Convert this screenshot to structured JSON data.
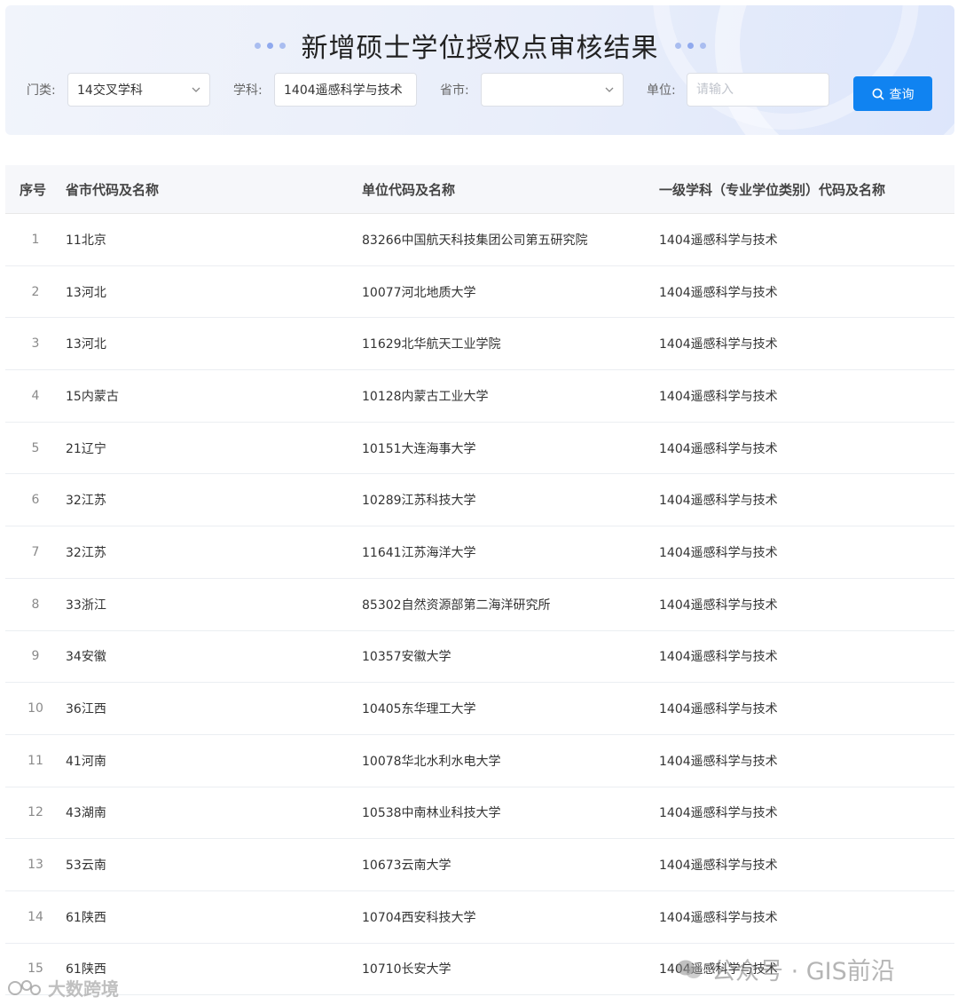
{
  "header": {
    "title": "新增硕士学位授权点审核结果"
  },
  "filters": {
    "category_label": "门类:",
    "category_value": "14交叉学科",
    "subject_label": "学科:",
    "subject_value": "1404遥感科学与技术",
    "province_label": "省市:",
    "province_value": "",
    "unit_label": "单位:",
    "unit_placeholder": "请输入",
    "query_label": "查询"
  },
  "table": {
    "headers": [
      "序号",
      "省市代码及名称",
      "单位代码及名称",
      "一级学科（专业学位类别）代码及名称"
    ],
    "rows": [
      {
        "idx": "1",
        "province": "11北京",
        "unit": "83266中国航天科技集团公司第五研究院",
        "subject": "1404遥感科学与技术"
      },
      {
        "idx": "2",
        "province": "13河北",
        "unit": "10077河北地质大学",
        "subject": "1404遥感科学与技术"
      },
      {
        "idx": "3",
        "province": "13河北",
        "unit": "11629北华航天工业学院",
        "subject": "1404遥感科学与技术"
      },
      {
        "idx": "4",
        "province": "15内蒙古",
        "unit": "10128内蒙古工业大学",
        "subject": "1404遥感科学与技术"
      },
      {
        "idx": "5",
        "province": "21辽宁",
        "unit": "10151大连海事大学",
        "subject": "1404遥感科学与技术"
      },
      {
        "idx": "6",
        "province": "32江苏",
        "unit": "10289江苏科技大学",
        "subject": "1404遥感科学与技术"
      },
      {
        "idx": "7",
        "province": "32江苏",
        "unit": "11641江苏海洋大学",
        "subject": "1404遥感科学与技术"
      },
      {
        "idx": "8",
        "province": "33浙江",
        "unit": "85302自然资源部第二海洋研究所",
        "subject": "1404遥感科学与技术"
      },
      {
        "idx": "9",
        "province": "34安徽",
        "unit": "10357安徽大学",
        "subject": "1404遥感科学与技术"
      },
      {
        "idx": "10",
        "province": "36江西",
        "unit": "10405东华理工大学",
        "subject": "1404遥感科学与技术"
      },
      {
        "idx": "11",
        "province": "41河南",
        "unit": "10078华北水利水电大学",
        "subject": "1404遥感科学与技术"
      },
      {
        "idx": "12",
        "province": "43湖南",
        "unit": "10538中南林业科技大学",
        "subject": "1404遥感科学与技术"
      },
      {
        "idx": "13",
        "province": "53云南",
        "unit": "10673云南大学",
        "subject": "1404遥感科学与技术"
      },
      {
        "idx": "14",
        "province": "61陕西",
        "unit": "10704西安科技大学",
        "subject": "1404遥感科学与技术"
      },
      {
        "idx": "15",
        "province": "61陕西",
        "unit": "10710长安大学",
        "subject": "1404遥感科学与技术"
      }
    ]
  },
  "watermarks": {
    "right": "公众号 · GIS前沿",
    "left": "大数跨境"
  },
  "colors": {
    "accent": "#1083f1",
    "header_bg": "#f6f7fa"
  }
}
